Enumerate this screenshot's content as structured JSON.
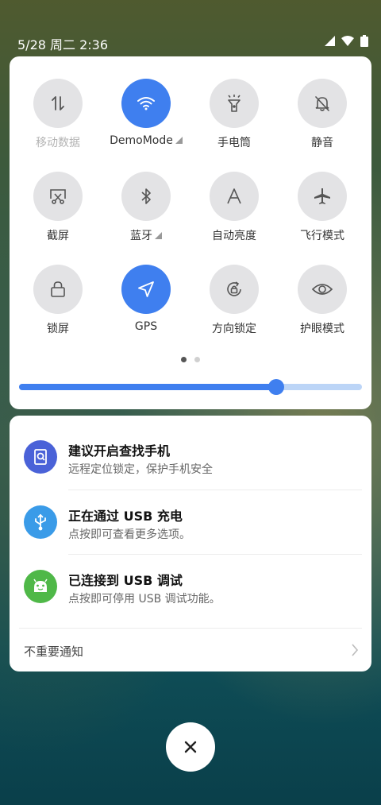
{
  "status_bar": {
    "datetime": "5/28 周二 2:36",
    "icons": [
      "signal-icon",
      "wifi-icon",
      "battery-icon"
    ]
  },
  "quick_settings": {
    "tiles": [
      {
        "label": "移动数据",
        "icon": "mobile-data-icon",
        "active": false,
        "dim": true
      },
      {
        "label": "DemoMode",
        "icon": "wifi-icon",
        "active": true,
        "expandable": true
      },
      {
        "label": "手电筒",
        "icon": "flashlight-icon",
        "active": false
      },
      {
        "label": "静音",
        "icon": "bell-off-icon",
        "active": false
      },
      {
        "label": "截屏",
        "icon": "screenshot-icon",
        "active": false
      },
      {
        "label": "蓝牙",
        "icon": "bluetooth-icon",
        "active": false,
        "expandable": true
      },
      {
        "label": "自动亮度",
        "icon": "auto-brightness-icon",
        "active": false
      },
      {
        "label": "飞行模式",
        "icon": "airplane-icon",
        "active": false
      },
      {
        "label": "锁屏",
        "icon": "lock-icon",
        "active": false
      },
      {
        "label": "GPS",
        "icon": "location-icon",
        "active": true
      },
      {
        "label": "方向锁定",
        "icon": "rotation-lock-icon",
        "active": false
      },
      {
        "label": "护眼模式",
        "icon": "eye-icon",
        "active": false
      }
    ],
    "page_count": 2,
    "current_page": 1,
    "brightness_fraction": 0.75
  },
  "notifications": {
    "items": [
      {
        "title": "建议开启查找手机",
        "text": "远程定位锁定，保护手机安全",
        "icon": "find-phone-icon",
        "color": "#4a62d8"
      },
      {
        "title": "正在通过 USB 充电",
        "text": "点按即可查看更多选项。",
        "icon": "usb-icon",
        "color": "#3a9be8"
      },
      {
        "title": "已连接到 USB 调试",
        "text": "点按即可停用 USB 调试功能。",
        "icon": "android-icon",
        "color": "#4fb848"
      }
    ],
    "unimportant_label": "不重要通知"
  },
  "colors": {
    "accent": "#3f7fef",
    "tile_inactive": "#e3e3e5",
    "panel_bg": "#ffffff"
  }
}
